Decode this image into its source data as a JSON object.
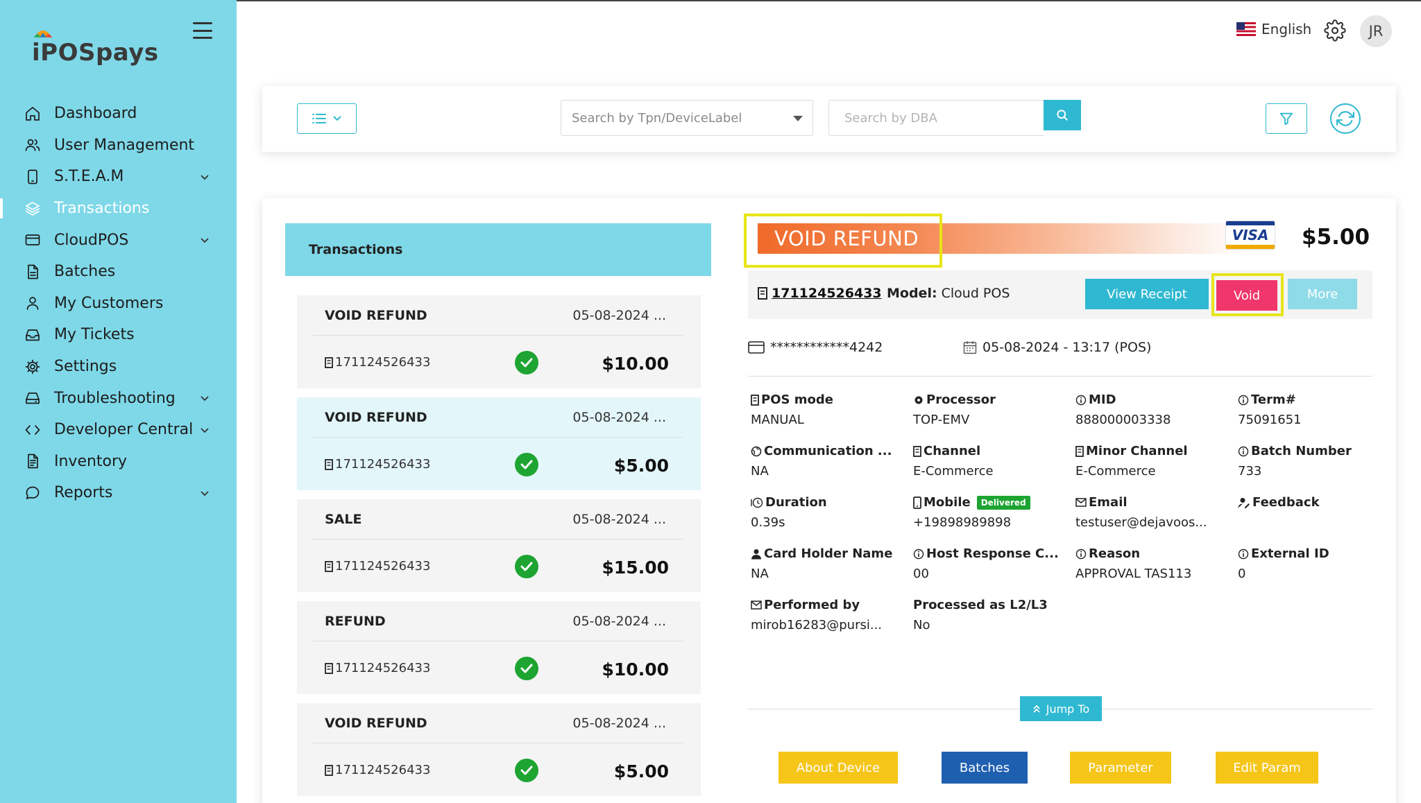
{
  "app": {
    "logo_text": "POSpays",
    "language": "English",
    "avatar_initials": "JR"
  },
  "sidebar": {
    "items": [
      {
        "label": "Dashboard",
        "icon": "home-icon",
        "active": false,
        "expandable": false
      },
      {
        "label": "User Management",
        "icon": "users-icon",
        "active": false,
        "expandable": false
      },
      {
        "label": "S.T.E.A.M",
        "icon": "device-icon",
        "active": false,
        "expandable": true
      },
      {
        "label": "Transactions",
        "icon": "layers-icon",
        "active": true,
        "expandable": false
      },
      {
        "label": "CloudPOS",
        "icon": "card-icon",
        "active": false,
        "expandable": true
      },
      {
        "label": "Batches",
        "icon": "file-icon",
        "active": false,
        "expandable": false
      },
      {
        "label": "My Customers",
        "icon": "user-icon",
        "active": false,
        "expandable": false
      },
      {
        "label": "My Tickets",
        "icon": "inbox-icon",
        "active": false,
        "expandable": false
      },
      {
        "label": "Settings",
        "icon": "gear-icon",
        "active": false,
        "expandable": false
      },
      {
        "label": "Troubleshooting",
        "icon": "drive-icon",
        "active": false,
        "expandable": true
      },
      {
        "label": "Developer Central",
        "icon": "code-icon",
        "active": false,
        "expandable": true
      },
      {
        "label": "Inventory",
        "icon": "document-icon",
        "active": false,
        "expandable": false
      },
      {
        "label": "Reports",
        "icon": "chat-icon",
        "active": false,
        "expandable": true
      }
    ]
  },
  "search": {
    "tpn_placeholder": "Search by Tpn/DeviceLabel",
    "dba_placeholder": "Search by DBA"
  },
  "transactions": {
    "header": "Transactions",
    "items": [
      {
        "type": "VOID REFUND",
        "date": "05-08-2024 ...",
        "id": "171124526433",
        "amount": "$10.00",
        "selected": false
      },
      {
        "type": "VOID REFUND",
        "date": "05-08-2024 ...",
        "id": "171124526433",
        "amount": "$5.00",
        "selected": true
      },
      {
        "type": "SALE",
        "date": "05-08-2024 ...",
        "id": "171124526433",
        "amount": "$15.00",
        "selected": false
      },
      {
        "type": "REFUND",
        "date": "05-08-2024 ...",
        "id": "171124526433",
        "amount": "$10.00",
        "selected": false
      },
      {
        "type": "VOID REFUND",
        "date": "05-08-2024 ...",
        "id": "171124526433",
        "amount": "$5.00",
        "selected": false
      }
    ]
  },
  "detail": {
    "status": "VOID REFUND",
    "card_brand": "VISA",
    "amount": "$5.00",
    "record_id": "171124526433",
    "model_label": "Model:",
    "model_value": "Cloud POS",
    "view_receipt_label": "View Receipt",
    "void_label": "Void",
    "more_label": "More",
    "card_number": "************4242",
    "datetime": "05-08-2024 - 13:17 (POS)",
    "fields": [
      {
        "label": "POS mode",
        "value": "MANUAL",
        "icon": "receipt-icon"
      },
      {
        "label": "Processor",
        "value": "TOP-EMV",
        "icon": "cog-icon"
      },
      {
        "label": "MID",
        "value": "888000003338",
        "icon": "info-icon"
      },
      {
        "label": "Term#",
        "value": "75091651",
        "icon": "info-icon"
      },
      {
        "label": "Communication ...",
        "value": "NA",
        "icon": "globe-icon"
      },
      {
        "label": "Channel",
        "value": "E-Commerce",
        "icon": "receipt-icon"
      },
      {
        "label": "Minor Channel",
        "value": "E-Commerce",
        "icon": "receipt-icon"
      },
      {
        "label": "Batch Number",
        "value": "733",
        "icon": "info-icon"
      },
      {
        "label": "Duration",
        "value": "0.39s",
        "icon": "clock-icon"
      },
      {
        "label": "Mobile",
        "value": "+19898989898",
        "icon": "mobile-icon",
        "badge": "Delivered"
      },
      {
        "label": "Email",
        "value": "testuser@dejavoos...",
        "icon": "mail-icon"
      },
      {
        "label": "Feedback",
        "value": "",
        "icon": "person-edit-icon"
      },
      {
        "label": "Card Holder Name",
        "value": "NA",
        "icon": "person-icon"
      },
      {
        "label": "Host Response C...",
        "value": "00",
        "icon": "info-icon"
      },
      {
        "label": "Reason",
        "value": "APPROVAL TAS113",
        "icon": "info-icon"
      },
      {
        "label": "External ID",
        "value": "0",
        "icon": "info-icon"
      },
      {
        "label": "Performed by",
        "value": "mirob16283@pursi...",
        "icon": "mail-icon"
      },
      {
        "label": "Processed as L2/L3",
        "value": "No",
        "icon": ""
      }
    ],
    "jump_to_label": "Jump To",
    "bottom_buttons": {
      "about_device": "About Device",
      "batches": "Batches",
      "parameter": "Parameter",
      "edit_param": "Edit Param"
    }
  },
  "colors": {
    "sidebar_bg": "#7fd8e8",
    "accent": "#2fb8d1",
    "void_button": "#f0366a",
    "success": "#1da431",
    "highlight_box": "#e8e418",
    "status_orange": "#f06a2a",
    "yellow_button": "#f5c518",
    "blue_button": "#1f5fb0"
  }
}
